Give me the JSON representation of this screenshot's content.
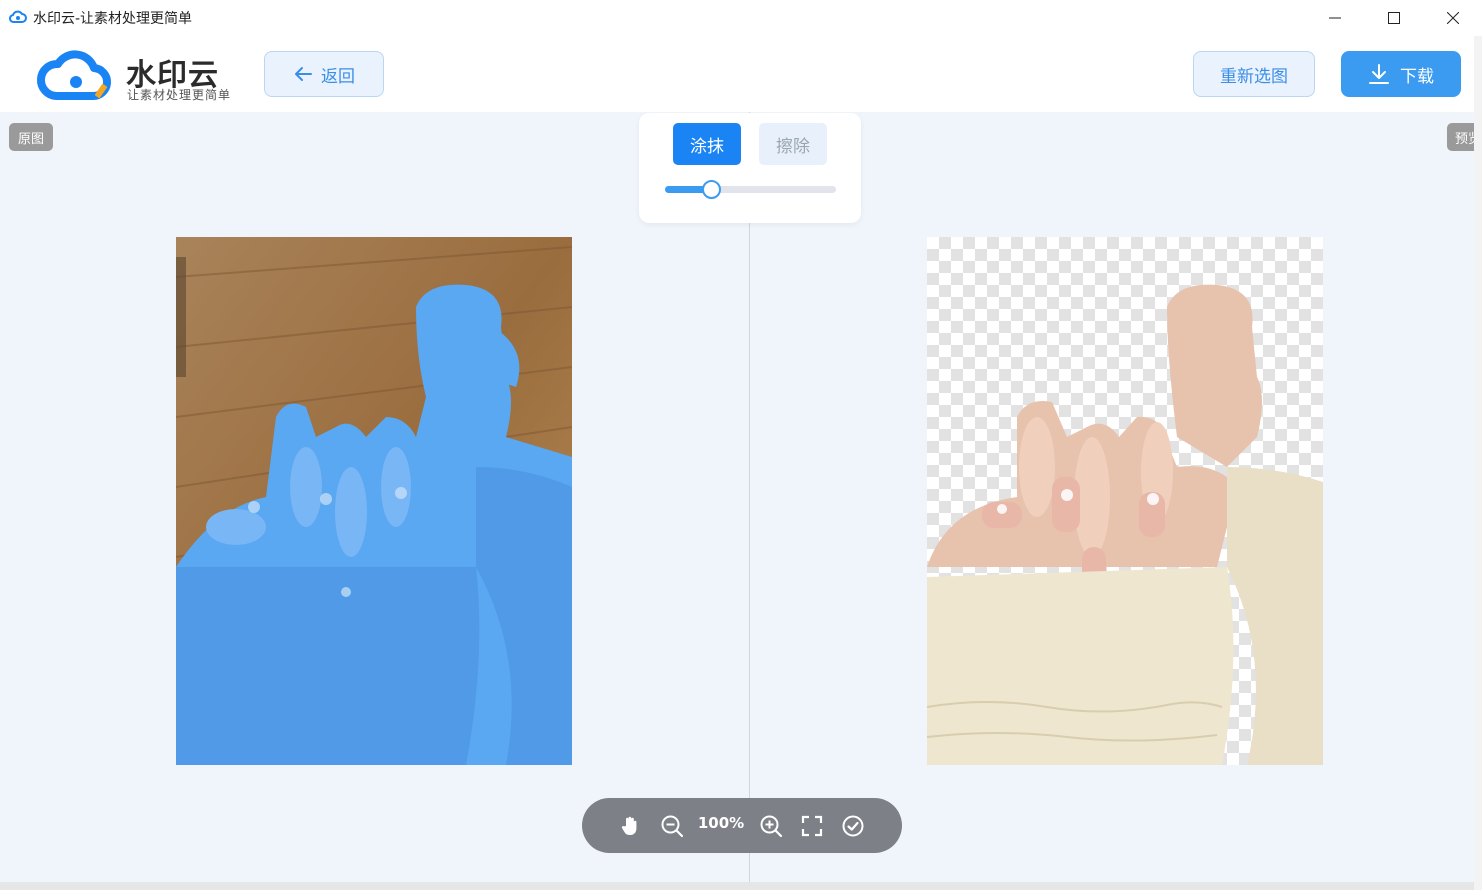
{
  "window": {
    "title": "水印云-让素材处理更简单"
  },
  "header": {
    "logo_text": "水印云",
    "logo_slogan": "让素材处理更简单",
    "back_label": "返回",
    "reselect_label": "重新选图",
    "download_label": "下载"
  },
  "labels": {
    "original": "原图",
    "preview": "预览"
  },
  "tools": {
    "smear_label": "涂抹",
    "erase_label": "擦除",
    "brush_size_fraction": 0.27
  },
  "zoom": {
    "value": "100%"
  },
  "colors": {
    "accent": "#3b9bf0",
    "active_tool": "#1a84f4",
    "workspace_bg": "#f0f4fb",
    "mask_blue": "#5aa7f2"
  }
}
